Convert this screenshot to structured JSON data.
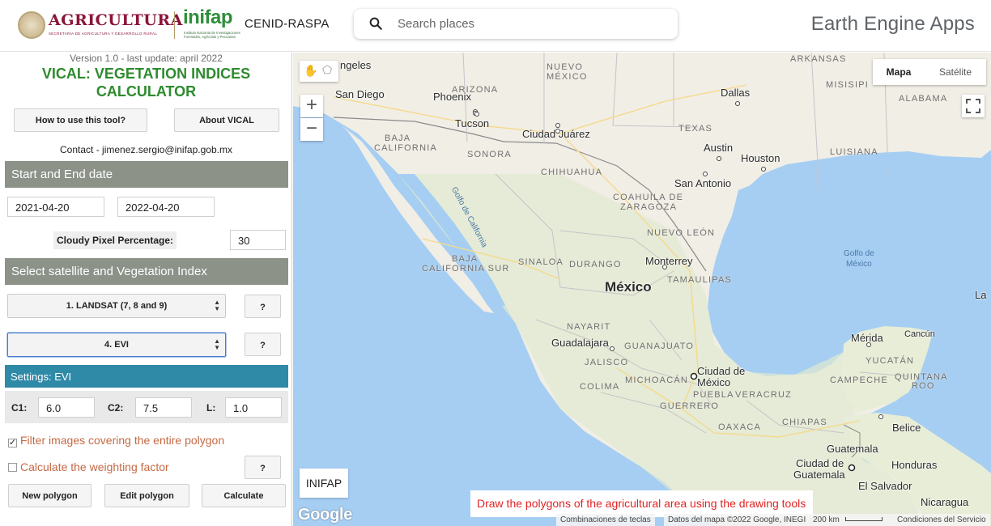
{
  "header": {
    "agri_logo_title": "AGRICULTURA",
    "agri_logo_subtitle": "SECRETARÍA DE AGRICULTURA Y DESARROLLO RURAL",
    "inifap_logo_word": "inifap",
    "inifap_logo_subtitle": "Instituto Nacional de Investigaciones Forestales, Agrícolas y Pecuarias",
    "center_name": "CENID-RASPA",
    "search_placeholder": "Search places",
    "app_platform_title": "Earth Engine Apps"
  },
  "panel": {
    "version": "Version 1.0 - last update: april 2022",
    "title_line1": "VICAL: VEGETATION INDICES",
    "title_line2": "CALCULATOR",
    "how_to_label": "How to use this tool?",
    "about_label": "About VICAL",
    "contact": "Contact - jimenez.sergio@inifap.gob.mx",
    "dates_section": "Start and End date",
    "start_date": "2021-04-20",
    "end_date": "2022-04-20",
    "cloudy_label": "Cloudy Pixel Percentage:",
    "cloudy_value": "30",
    "satellite_section": "Select satellite and Vegetation Index",
    "satellite_selected": "1. LANDSAT (7, 8 and 9)",
    "index_selected": "4. EVI",
    "help_label": "?",
    "settings_title": "Settings: EVI",
    "c1_label": "C1:",
    "c1_value": "6.0",
    "c2_label": "C2:",
    "c2_value": "7.5",
    "l_label": "L:",
    "l_value": "1.0",
    "filter_label": "Filter images covering the entire polygon",
    "filter_checked": true,
    "weighting_label": "Calculate the weighting factor",
    "weighting_checked": false,
    "new_polygon_label": "New polygon",
    "edit_polygon_label": "Edit polygon",
    "calculate_label": "Calculate"
  },
  "map": {
    "map_type_options": [
      "Mapa",
      "Satélite"
    ],
    "map_type_selected": "Mapa",
    "zoom_in_label": "+",
    "zoom_out_label": "−",
    "inifap_button": "INIFAP",
    "hint": "Draw the polygons of the agricultural area using the drawing tools",
    "google_logo": "Google",
    "attribution_shortcuts": "Combinaciones de teclas",
    "attribution_data": "Datos del mapa ©2022 Google, INEGI",
    "scale_label": "200 km",
    "attribution_terms": "Condiciones del Servicio",
    "labels": {
      "angeles": "ngeles",
      "san_diego": "San Diego",
      "phoenix": "Phoenix",
      "tucson": "Tucson",
      "arizona": "ARIZONA",
      "nuevo_mexico_1": "NUEVO",
      "nuevo_mexico_2": "MÉXICO",
      "arkansas": "ARKANSAS",
      "misisipi": "MISISIPI",
      "alabama": "ALABAMA",
      "dallas": "Dallas",
      "texas": "TEXAS",
      "austin": "Austin",
      "houston": "Houston",
      "luisiana": "LUISIANA",
      "san_antonio": "San Antonio",
      "ciudad_juarez": "Ciudad Juárez",
      "sonora": "SONORA",
      "chihuahua": "CHIHUAHUA",
      "baja_california_1": "BAJA",
      "baja_california_2": "CALIFORNIA",
      "baja_california_sur_1": "BAJA",
      "baja_california_sur_2": "CALIFORNIA SUR",
      "golfo_california": "Golfo de California",
      "coahuila_1": "COAHUILA DE",
      "coahuila_2": "ZARAGOZA",
      "nuevo_leon": "NUEVO LEÓN",
      "monterrey": "Monterrey",
      "sinaloa": "SINALOA",
      "durango": "DURANGO",
      "mexico": "México",
      "tamaulipas": "TAMAULIPAS",
      "golfo_mexico_1": "Golfo de",
      "golfo_mexico_2": "México",
      "nayarit": "NAYARIT",
      "guadalajara": "Guadalajara",
      "guanajuato": "GUANAJUATO",
      "jalisco": "JALISCO",
      "ciudad_mexico_1": "Ciudad de",
      "ciudad_mexico_2": "México",
      "michoacan": "MICHOACÁN",
      "colima": "COLIMA",
      "puebla": "PUEBLA",
      "veracruz": "VERACRUZ",
      "guerrero": "GUERRERO",
      "oaxaca": "OAXACA",
      "chiapas": "CHIAPAS",
      "merida": "Mérida",
      "cancun": "Cancún",
      "yucatan": "YUCATÁN",
      "campeche": "CAMPECHE",
      "quintana_roo_1": "QUINTANA",
      "quintana_roo_2": "ROO",
      "belice": "Belice",
      "guatemala": "Guatemala",
      "ciudad_guatemala_1": "Ciudad de",
      "ciudad_guatemala_2": "Guatemala",
      "honduras": "Honduras",
      "el_salvador": "El Salvador",
      "nicaragua": "Nicaragua",
      "la": "La"
    }
  }
}
